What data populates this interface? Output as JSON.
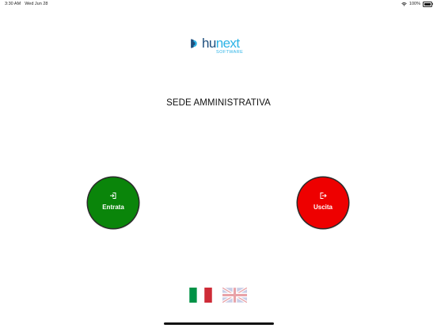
{
  "status_bar": {
    "time": "3:30 AM",
    "date": "Wed Jun 28",
    "battery_percent": "100%",
    "icons": [
      "wifi-icon",
      "battery-icon"
    ]
  },
  "logo": {
    "text_primary": "hu",
    "text_accent": "next",
    "subtitle": "SOFTWARE"
  },
  "header": {
    "title": "SEDE AMMINISTRATIVA"
  },
  "actions": {
    "entrata": {
      "label": "Entrata",
      "icon": "login-icon",
      "color": "#0a850a"
    },
    "uscita": {
      "label": "Uscita",
      "icon": "logout-icon",
      "color": "#ee0000"
    }
  },
  "languages": [
    {
      "code": "it",
      "icon": "italian-flag-icon"
    },
    {
      "code": "en",
      "icon": "uk-flag-icon"
    }
  ],
  "colors": {
    "brand_dark": "#1e4f7e",
    "brand_light": "#2bb3e6"
  }
}
